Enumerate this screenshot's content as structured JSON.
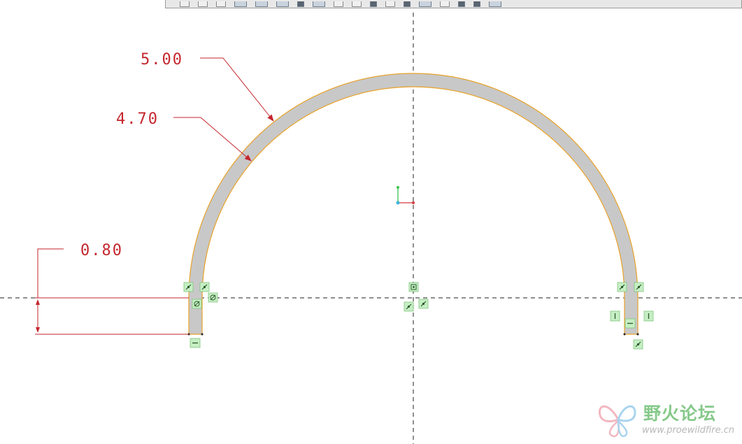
{
  "toolbar": {
    "icons": [
      "undo-icon",
      "redo-icon",
      "back-icon",
      "sketch-icon",
      "view-icon",
      "layer-icon",
      "print-icon",
      "save-icon",
      "page-icon",
      "fix-icon",
      "constraint-icon",
      "dimension-icon",
      "modify-icon",
      "palette-icon",
      "refit-icon",
      "zoom-icon",
      "spin-icon",
      "display-icon"
    ]
  },
  "dimensions": {
    "outer_radius": "5.00",
    "inner_radius": "4.70",
    "leg_height": "0.80"
  },
  "constraints": {
    "tangent_icon": "tangent-icon",
    "horizontal_icon": "horizontal-icon",
    "vertical_icon": "vertical-icon",
    "midpoint_icon": "midpoint-icon",
    "symmetric_icon": "symmetric-icon"
  },
  "colors": {
    "dimension": "#c4262e",
    "sketch_fill": "#c8c8c8",
    "sketch_edge": "#e8a22a",
    "constraint_bg": "#c6eec4",
    "axis_x": "#d43a3a",
    "axis_y": "#3cc44a"
  },
  "watermark": {
    "title": "野火论坛",
    "url": "www.proewildfire.cn"
  }
}
